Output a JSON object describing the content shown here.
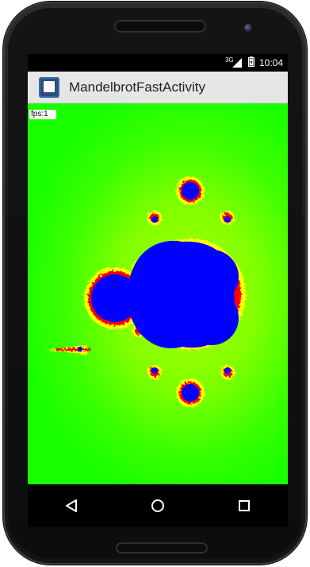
{
  "status_bar": {
    "network_type": "3G",
    "time": "10:04"
  },
  "action_bar": {
    "title": "MandelbrotFastActivity",
    "icon": "app-launcher-icon"
  },
  "content": {
    "fps_label": "fps:1"
  },
  "navigation": {
    "back_icon": "back-triangle-icon",
    "home_icon": "home-circle-icon",
    "recents_icon": "recents-square-icon"
  },
  "colors": {
    "fractal_inside": "#0000ff",
    "fractal_edge": "#ff0000",
    "fractal_halo": "#ffff00",
    "fractal_outside": "#33ff00",
    "action_bar": "#e6e6e6",
    "status_bar": "#000000",
    "nav_bar": "#000000"
  }
}
